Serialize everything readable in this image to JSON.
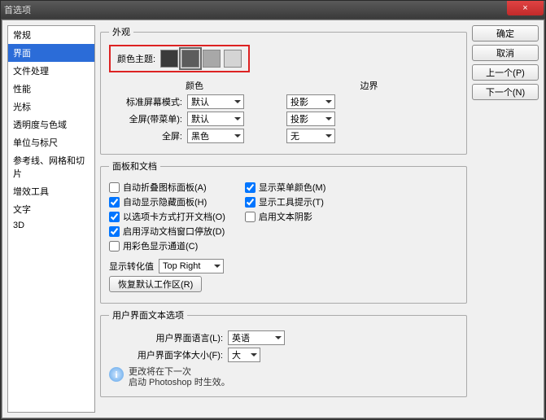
{
  "window": {
    "title": "首选项",
    "close": "×"
  },
  "sidebar": [
    "常规",
    "界面",
    "文件处理",
    "性能",
    "光标",
    "透明度与色域",
    "单位与标尺",
    "参考线、网格和切片",
    "增效工具",
    "文字",
    "3D"
  ],
  "sidebar_selected": 1,
  "buttons": {
    "ok": "确定",
    "cancel": "取消",
    "prev": "上一个(P)",
    "next": "下一个(N)"
  },
  "appearance": {
    "legend": "外观",
    "theme_label": "颜色主题:",
    "swatches": [
      "#3a3a3a",
      "#5c5c5c",
      "#a8a8a8",
      "#d4d4d4"
    ],
    "selected_swatch": 1,
    "col_color": "颜色",
    "col_border": "边界",
    "rows": [
      {
        "label": "标准屏幕模式:",
        "color": "默认",
        "border": "投影"
      },
      {
        "label": "全屏(带菜单):",
        "color": "默认",
        "border": "投影"
      },
      {
        "label": "全屏:",
        "color": "黑色",
        "border": "无"
      }
    ]
  },
  "panels": {
    "legend": "面板和文档",
    "left": [
      {
        "label": "自动折叠图标面板(A)",
        "checked": false
      },
      {
        "label": "自动显示隐藏面板(H)",
        "checked": true
      },
      {
        "label": "以选项卡方式打开文档(O)",
        "checked": true
      },
      {
        "label": "启用浮动文档窗口停放(D)",
        "checked": true
      },
      {
        "label": "用彩色显示通道(C)",
        "checked": false
      }
    ],
    "right": [
      {
        "label": "显示菜单颜色(M)",
        "checked": true
      },
      {
        "label": "显示工具提示(T)",
        "checked": true
      },
      {
        "label": "启用文本阴影",
        "checked": false
      }
    ],
    "transform_label": "显示转化值",
    "transform_value": "Top Right",
    "reset_btn": "恢复默认工作区(R)"
  },
  "ui_text": {
    "legend": "用户界面文本选项",
    "lang_label": "用户界面语言(L):",
    "lang_value": "英语",
    "size_label": "用户界面字体大小(F):",
    "size_value": "大",
    "note_title": "更改将在下一次",
    "note_body": "启动 Photoshop 时生效。"
  }
}
